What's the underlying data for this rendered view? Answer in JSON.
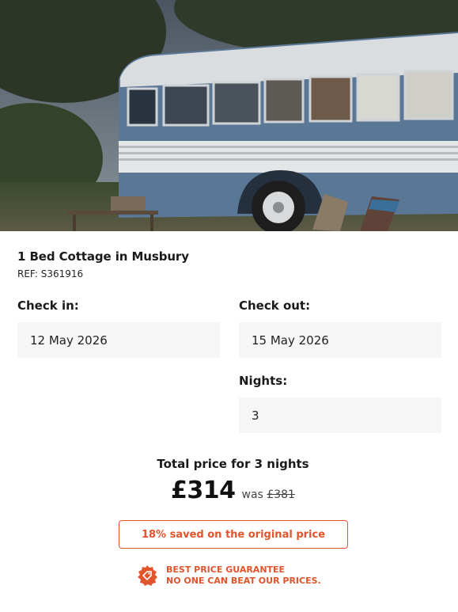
{
  "listing": {
    "title": "1 Bed Cottage in Musbury",
    "ref": "REF: S361916"
  },
  "booking": {
    "check_in_label": "Check in:",
    "check_in_value": "12 May 2026",
    "check_out_label": "Check out:",
    "check_out_value": "15 May 2026",
    "nights_label": "Nights:",
    "nights_value": "3"
  },
  "pricing": {
    "total_label": "Total price for 3 nights",
    "price": "£314",
    "was_prefix": "was",
    "was_price": "£381",
    "saved_text": "18% saved on the original price"
  },
  "guarantee": {
    "line1": "BEST PRICE GUARANTEE",
    "line2": "NO ONE CAN BEAT OUR PRICES.",
    "icon": "price-tag-badge-icon"
  },
  "colors": {
    "accent": "#e2542b",
    "field_bg": "#f6f6f6"
  }
}
